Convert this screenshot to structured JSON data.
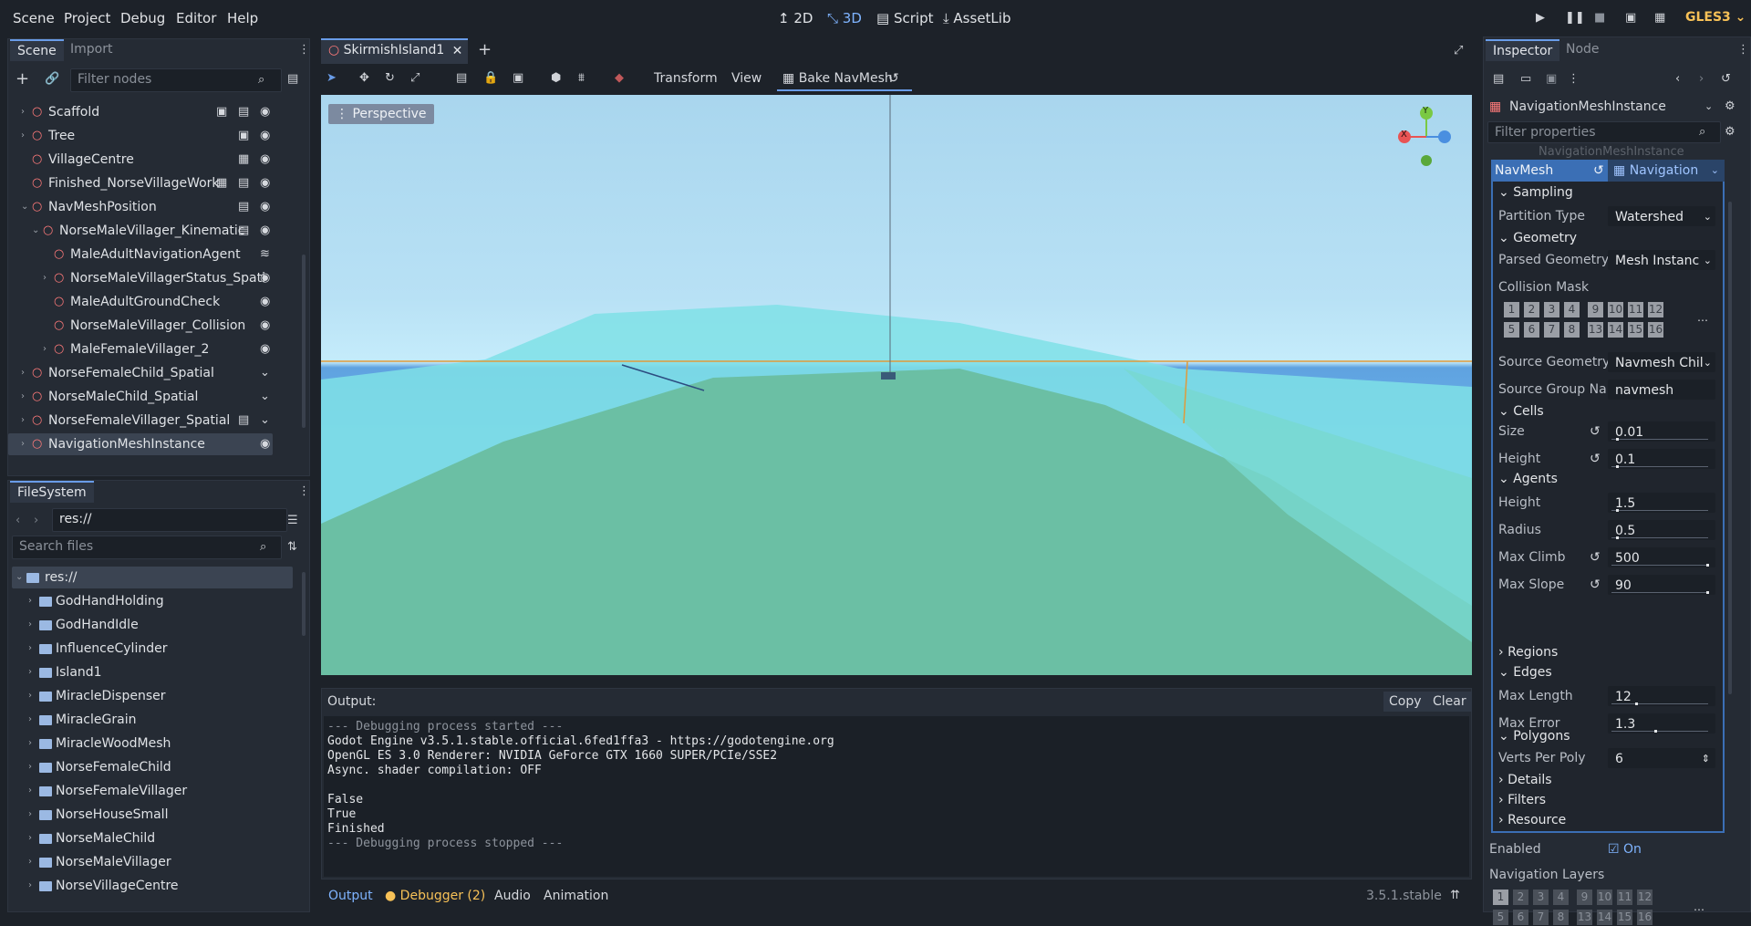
{
  "menu": {
    "items": [
      "Scene",
      "Project",
      "Debug",
      "Editor",
      "Help"
    ]
  },
  "workspaces": {
    "w2d": "2D",
    "w3d": "3D",
    "script": "Script",
    "assetlib": "AssetLib"
  },
  "renderer": "GLES3",
  "scene_dock": {
    "tabs": [
      "Scene",
      "Import"
    ],
    "filter_placeholder": "Filter nodes",
    "nodes": [
      {
        "label": "Scaffold",
        "indent": 1,
        "arrow": "›",
        "color": "#ff7a7a"
      },
      {
        "label": "Tree",
        "indent": 1,
        "arrow": "›",
        "color": "#ff7a7a"
      },
      {
        "label": "VillageCentre",
        "indent": 1,
        "arrow": "",
        "color": "#ff7a7a"
      },
      {
        "label": "Finished_NorseVillageWork",
        "indent": 1,
        "arrow": "",
        "color": "#ff7a7a"
      },
      {
        "label": "NavMeshPosition",
        "indent": 1,
        "arrow": "⌄",
        "color": "#ff7a7a"
      },
      {
        "label": "NorseMaleVillager_Kinematic",
        "indent": 2,
        "arrow": "⌄",
        "color": "#ff7a7a"
      },
      {
        "label": "MaleAdultNavigationAgent",
        "indent": 3,
        "arrow": "",
        "color": "#ff7a7a"
      },
      {
        "label": "NorseMaleVillagerStatus_Spati",
        "indent": 3,
        "arrow": "›",
        "color": "#ff7a7a"
      },
      {
        "label": "MaleAdultGroundCheck",
        "indent": 3,
        "arrow": "",
        "color": "#ff7a7a"
      },
      {
        "label": "NorseMaleVillager_Collision",
        "indent": 3,
        "arrow": "",
        "color": "#ff7a7a"
      },
      {
        "label": "MaleFemaleVillager_2",
        "indent": 3,
        "arrow": "›",
        "color": "#ff7a7a"
      },
      {
        "label": "NorseFemaleChild_Spatial",
        "indent": 1,
        "arrow": "›",
        "color": "#ff7a7a"
      },
      {
        "label": "NorseMaleChild_Spatial",
        "indent": 1,
        "arrow": "›",
        "color": "#ff7a7a"
      },
      {
        "label": "NorseFemaleVillager_Spatial",
        "indent": 1,
        "arrow": "›",
        "color": "#ff7a7a"
      },
      {
        "label": "NavigationMeshInstance",
        "indent": 1,
        "arrow": "›",
        "color": "#ff7a7a"
      }
    ]
  },
  "filesystem": {
    "title": "FileSystem",
    "path": "res://",
    "search_placeholder": "Search files",
    "root": "res://",
    "folders": [
      "GodHandHolding",
      "GodHandIdle",
      "InfluenceCylinder",
      "Island1",
      "MiracleDispenser",
      "MiracleGrain",
      "MiracleWoodMesh",
      "NorseFemaleChild",
      "NorseFemaleVillager",
      "NorseHouseSmall",
      "NorseMaleChild",
      "NorseMaleVillager",
      "NorseVillageCentre"
    ]
  },
  "editor": {
    "scene_tab": "SkirmishIsland1",
    "toolbar": {
      "transform": "Transform",
      "view": "View",
      "bake": "Bake NavMesh"
    },
    "perspective": "Perspective",
    "gizmo": {
      "x": "X",
      "y": "Y"
    }
  },
  "output": {
    "title": "Output:",
    "copy": "Copy",
    "clear": "Clear",
    "lines": [
      {
        "text": "--- Debugging process started ---",
        "dim": true
      },
      {
        "text": "Godot Engine v3.5.1.stable.official.6fed1ffa3 - https://godotengine.org",
        "dim": false
      },
      {
        "text": "OpenGL ES 3.0 Renderer: NVIDIA GeForce GTX 1660 SUPER/PCIe/SSE2",
        "dim": false
      },
      {
        "text": "Async. shader compilation: OFF",
        "dim": false
      },
      {
        "text": "",
        "dim": false
      },
      {
        "text": "False",
        "dim": false
      },
      {
        "text": "True",
        "dim": false
      },
      {
        "text": "Finished",
        "dim": false
      },
      {
        "text": "--- Debugging process stopped ---",
        "dim": true
      }
    ]
  },
  "bottom_tabs": {
    "output": "Output",
    "debugger": "Debugger (2)",
    "audio": "Audio",
    "animation": "Animation",
    "version": "3.5.1.stable"
  },
  "inspector": {
    "tabs": [
      "Inspector",
      "Node"
    ],
    "object": "NavigationMeshInstance",
    "filter_placeholder": "Filter properties",
    "ghost": "NavigationMeshInstance",
    "navmesh_label": "NavMesh",
    "navmesh_value": "Navigation",
    "sections": {
      "sampling": "Sampling",
      "geometry": "Geometry",
      "cells": "Cells",
      "agents": "Agents",
      "regions": "Regions",
      "edges": "Edges",
      "polygons": "Polygons",
      "details": "Details",
      "filters": "Filters",
      "resource": "Resource"
    },
    "props": {
      "partition_type": {
        "label": "Partition Type",
        "value": "Watershed"
      },
      "parsed_geometry": {
        "label": "Parsed Geometry",
        "value": "Mesh Instanc"
      },
      "collision_mask": {
        "label": "Collision Mask"
      },
      "source_geometry": {
        "label": "Source Geometry",
        "value": "Navmesh Chil"
      },
      "source_group": {
        "label": "Source Group Na",
        "value": "navmesh"
      },
      "cell_size": {
        "label": "Size",
        "value": "0.01"
      },
      "cell_height": {
        "label": "Height",
        "value": "0.1"
      },
      "agent_height": {
        "label": "Height",
        "value": "1.5"
      },
      "agent_radius": {
        "label": "Radius",
        "value": "0.5"
      },
      "max_climb": {
        "label": "Max Climb",
        "value": "500"
      },
      "max_slope": {
        "label": "Max Slope",
        "value": "90"
      },
      "max_length": {
        "label": "Max Length",
        "value": "12"
      },
      "max_error": {
        "label": "Max Error",
        "value": "1.3"
      },
      "verts_per_poly": {
        "label": "Verts Per Poly",
        "value": "6"
      }
    },
    "enabled": {
      "label": "Enabled",
      "value": "On"
    },
    "nav_layers": {
      "label": "Navigation Layers"
    },
    "layer_numbers_row1": [
      "1",
      "2",
      "3",
      "4",
      "9",
      "10",
      "11",
      "12"
    ],
    "layer_numbers_row2": [
      "5",
      "6",
      "7",
      "8",
      "13",
      "14",
      "15",
      "16"
    ]
  }
}
